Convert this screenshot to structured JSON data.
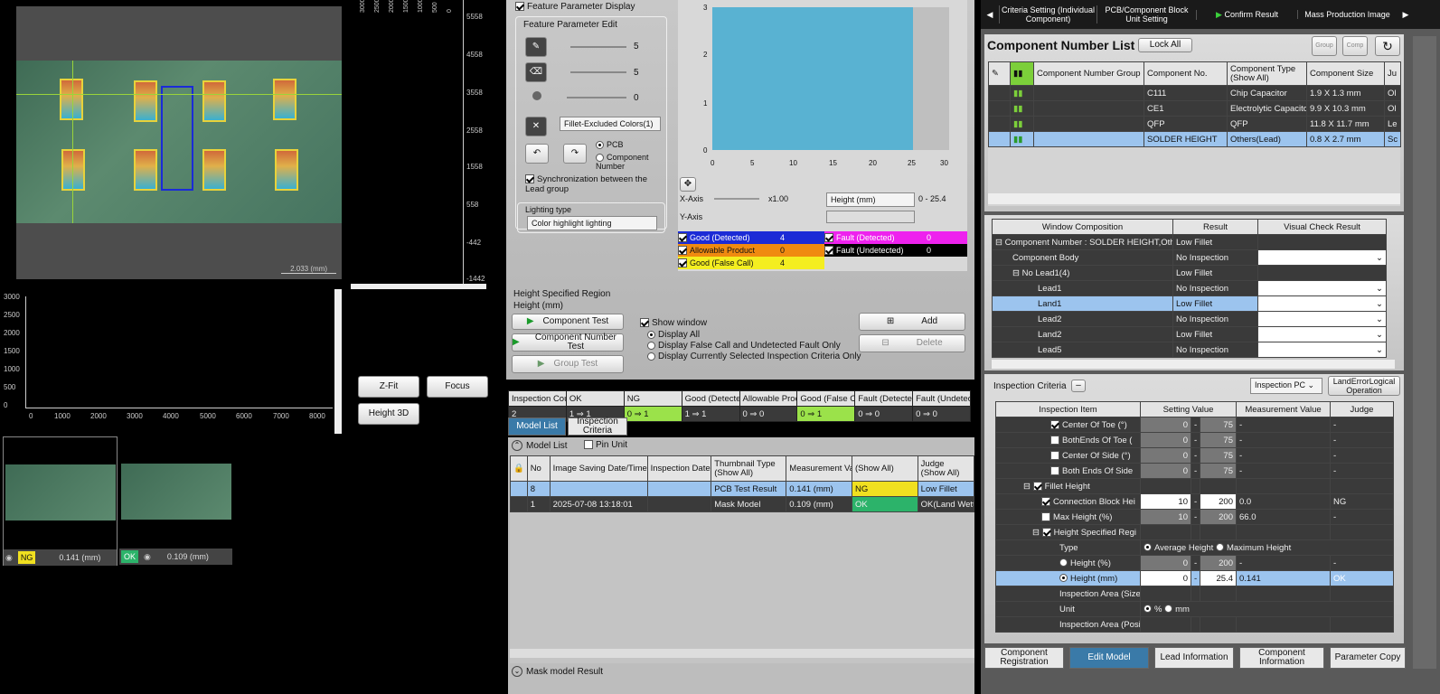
{
  "image_view": {
    "scale_label": "2.033 (mm)"
  },
  "vertical_ruler": {
    "top_labels": [
      "3000",
      "2500",
      "2000",
      "1500",
      "1000",
      "500",
      "0"
    ],
    "side_labels": [
      "5558",
      "4558",
      "3558",
      "2558",
      "1558",
      "558",
      "-442",
      "-1442"
    ]
  },
  "profile_chart": {
    "y_labels": [
      "3000",
      "2500",
      "2000",
      "1500",
      "1000",
      "500",
      "0"
    ],
    "x_labels": [
      "0",
      "1000",
      "2000",
      "3000",
      "4000",
      "5000",
      "6000",
      "7000",
      "8000"
    ]
  },
  "view_buttons": {
    "zfit": "Z-Fit",
    "focus": "Focus",
    "height3d": "Height 3D"
  },
  "thumbnails": [
    {
      "judge": "NG",
      "value": "0.141 (mm)",
      "color": "#f0e020"
    },
    {
      "judge": "OK",
      "value": "0.109 (mm)",
      "color": "#2cb36a"
    }
  ],
  "feature": {
    "display_label": "Feature Parameter Display",
    "edit_label": "Feature Parameter Edit",
    "slider_values": [
      "5",
      "5",
      "0"
    ],
    "fillet_select": "Fillet-Excluded Colors(1)",
    "radio_pcb": "PCB",
    "radio_component": "Component Number",
    "sync_label": "Synchronization between the Lead group",
    "lighting_label": "Lighting type",
    "lighting_value": "Color highlight lighting"
  },
  "histogram": {
    "y_labels": [
      "3",
      "2",
      "1",
      "0"
    ],
    "x_labels": [
      "0",
      "5",
      "10",
      "15",
      "20",
      "25",
      "30"
    ],
    "xaxis_label": "X-Axis",
    "yaxis_label": "Y-Axis",
    "zoom": "x1.00",
    "axis_select": "Height (mm)",
    "range": "0 - 25.4"
  },
  "legend": [
    {
      "label": "Good (Detected)",
      "count": "4",
      "color": "#1c2bd6"
    },
    {
      "label": "Allowable Product",
      "count": "0",
      "color": "#f08a10"
    },
    {
      "label": "Good (False Call)",
      "count": "4",
      "color": "#f4ee20"
    },
    {
      "label": "Fault (Detected)",
      "count": "0",
      "color": "#ee22ee"
    },
    {
      "label": "Fault (Undetected)",
      "count": "0",
      "color": "#000000"
    }
  ],
  "height_region": {
    "title": "Height Specified Region",
    "subtitle": "Height (mm)"
  },
  "test_buttons": {
    "component": "Component Test",
    "number": "Component Number Test",
    "group": "Group Test"
  },
  "show_window": {
    "label": "Show window",
    "options": [
      "Display All",
      "Display False Call and Undetected Fault Only",
      "Display Currently Selected Inspection Criteria Only"
    ]
  },
  "edit_buttons": {
    "add": "Add",
    "delete": "Delete"
  },
  "stats": {
    "headers": [
      "Inspection Cou",
      "OK",
      "NG",
      "Good (Detecte",
      "Allowable Proc",
      "Good (False Ca",
      "Fault (Detecte",
      "Fault (Undetec"
    ],
    "values": [
      "2",
      "1 ⇒ 1",
      "0 ⇒ 1",
      "1 ⇒ 1",
      "0 ⇒ 0",
      "0 ⇒ 1",
      "0 ⇒ 0",
      "0 ⇒ 0"
    ]
  },
  "model_tabs": {
    "model_list": "Model List",
    "criteria": "Inspection Criteria"
  },
  "model_list": {
    "title": "Model List",
    "pin": "Pin Unit",
    "headers": [
      "No",
      "Image Saving Date/Time",
      "Inspection Date",
      "Thumbnail Type (Show All)",
      "Measurement Va",
      "(Show All)",
      "Judge (Show All)"
    ],
    "rows": [
      {
        "no": "8",
        "saved": "",
        "date": "",
        "type": "PCB Test Result",
        "value": "0.141 (mm)",
        "judge": "NG",
        "detail": "Low Fillet"
      },
      {
        "no": "1",
        "saved": "2025-07-08 13:18:01",
        "date": "",
        "type": "Mask Model",
        "value": "0.109 (mm)",
        "judge": "OK",
        "detail": "OK(Land Wett"
      }
    ],
    "mask_result": "Mask model Result"
  },
  "top_toolbar": {
    "criteria": "Criteria Setting (Individual Component)",
    "block": "PCB/Component Block Unit Setting",
    "confirm": "Confirm Result",
    "mass": "Mass Production Image"
  },
  "component_list": {
    "title": "Component Number List",
    "lock": "Lock All",
    "group_btn": "Group",
    "comp_btn": "Comp",
    "headers": [
      "Component Number Group",
      "Component No.",
      "Component Type (Show All)",
      "Component Size",
      "Ju"
    ],
    "rows": [
      {
        "no": "C111",
        "type": "Chip Capacitor",
        "size": "1.9 X 1.3 mm",
        "ju": "Ol"
      },
      {
        "no": "CE1",
        "type": "Electrolytic Capacitor",
        "size": "9.9 X 10.3 mm",
        "ju": "Ol"
      },
      {
        "no": "QFP",
        "type": "QFP",
        "size": "11.8 X 11.7 mm",
        "ju": "Le"
      },
      {
        "no": "SOLDER HEIGHT",
        "type": "Others(Lead)",
        "size": "0.8 X 2.7 mm",
        "ju": "Sc"
      }
    ]
  },
  "window_comp": {
    "headers": [
      "Window Composition",
      "Result",
      "Visual Check Result"
    ],
    "rows": [
      {
        "name": "Component Number : SOLDER HEIGHT,Other",
        "result": "Low Fillet",
        "pink": true
      },
      {
        "name": "Component Body",
        "result": "No Inspection",
        "pink": false
      },
      {
        "name": "No Lead1(4)",
        "result": "Low Fillet",
        "pink": true
      },
      {
        "name": "Lead1",
        "result": "No Inspection",
        "pink": false
      },
      {
        "name": "Land1",
        "result": "Low Fillet",
        "pink": true
      },
      {
        "name": "Lead2",
        "result": "No Inspection",
        "pink": false
      },
      {
        "name": "Land2",
        "result": "Low Fillet",
        "pink": true
      },
      {
        "name": "Lead5",
        "result": "No Inspection",
        "pink": false
      }
    ]
  },
  "criteria": {
    "label": "Inspection Criteria",
    "pc_select": "Inspection PC",
    "land_error": "LandErrorLogical Operation",
    "headers": [
      "Inspection Item",
      "Setting Value",
      "Measurement Value",
      "Judge"
    ],
    "rows": [
      {
        "item": "Center Of Toe (°)",
        "v1": "0",
        "v2": "75",
        "meas": "-",
        "judge": "-"
      },
      {
        "item": "BothEnds Of Toe (",
        "v1": "0",
        "v2": "75",
        "meas": "-",
        "judge": "-"
      },
      {
        "item": "Center Of Side (°)",
        "v1": "0",
        "v2": "75",
        "meas": "-",
        "judge": "-"
      },
      {
        "item": "Both Ends Of Side",
        "v1": "0",
        "v2": "75",
        "meas": "-",
        "judge": "-"
      },
      {
        "item": "Fillet Height",
        "v1": "",
        "v2": "",
        "meas": "",
        "judge": ""
      },
      {
        "item": "Connection Block Hei",
        "v1": "10",
        "v2": "200",
        "meas": "0.0",
        "judge": "NG"
      },
      {
        "item": "Max Height (%)",
        "v1": "10",
        "v2": "200",
        "meas": "66.0",
        "judge": "-"
      },
      {
        "item": "Height Specified Regi",
        "v1": "",
        "v2": "",
        "meas": "",
        "judge": ""
      },
      {
        "item": "Type",
        "v1": "",
        "v2": "",
        "meas": "",
        "judge": ""
      },
      {
        "item": "Height (%)",
        "v1": "0",
        "v2": "200",
        "meas": "-",
        "judge": "-"
      },
      {
        "item": "Height (mm)",
        "v1": "0",
        "v2": "25.4",
        "meas": "0.141",
        "judge": "OK"
      },
      {
        "item": "Inspection Area (Size",
        "v1": "",
        "v2": "",
        "meas": "",
        "judge": ""
      },
      {
        "item": "Unit",
        "v1": "",
        "v2": "",
        "meas": "",
        "judge": ""
      },
      {
        "item": "Inspection Area (Posi",
        "v1": "",
        "v2": "",
        "meas": "",
        "judge": ""
      }
    ],
    "type_avg": "Average Height",
    "type_max": "Maximum Height",
    "unit_pct": "%",
    "unit_mm": "mm"
  },
  "bottom_tabs": [
    "Component Registration",
    "Edit Model",
    "Lead Information",
    "Component Information",
    "Parameter Copy"
  ]
}
